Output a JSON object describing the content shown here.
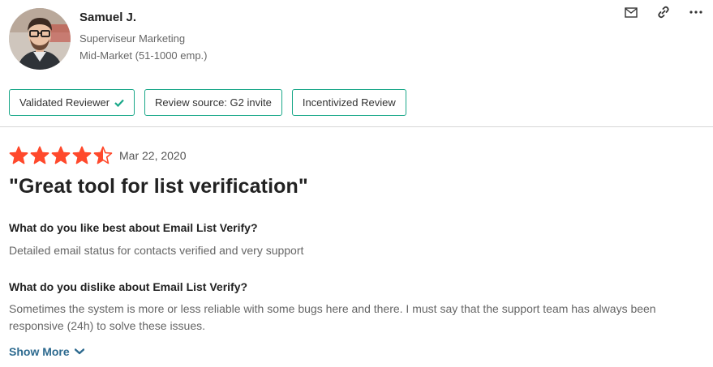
{
  "reviewer": {
    "name": "Samuel J.",
    "role": "Superviseur Marketing",
    "segment": "Mid-Market (51-1000 emp.)"
  },
  "actions": [
    {
      "icon": "mail-icon"
    },
    {
      "icon": "link-icon"
    },
    {
      "icon": "more-options-icon"
    }
  ],
  "badges": {
    "validated": "Validated Reviewer",
    "source": "Review source: G2 invite",
    "incentivized": "Incentivized Review"
  },
  "review": {
    "rating": 4.5,
    "max_rating": 5,
    "date": "Mar 22, 2020",
    "title": "\"Great tool for list verification\"",
    "like_question": "What do you like best about Email List Verify?",
    "like_answer": "Detailed email status for contacts verified and very support",
    "dislike_question": "What do you dislike about Email List Verify?",
    "dislike_answer": "Sometimes the system is more or less reliable with some bugs here and there. I must say that the support team has always been responsive (24h) to solve these issues.",
    "show_more": "Show More"
  },
  "colors": {
    "star": "#ff492c",
    "badge_border": "#1aa889",
    "link": "#2d6a8f"
  }
}
